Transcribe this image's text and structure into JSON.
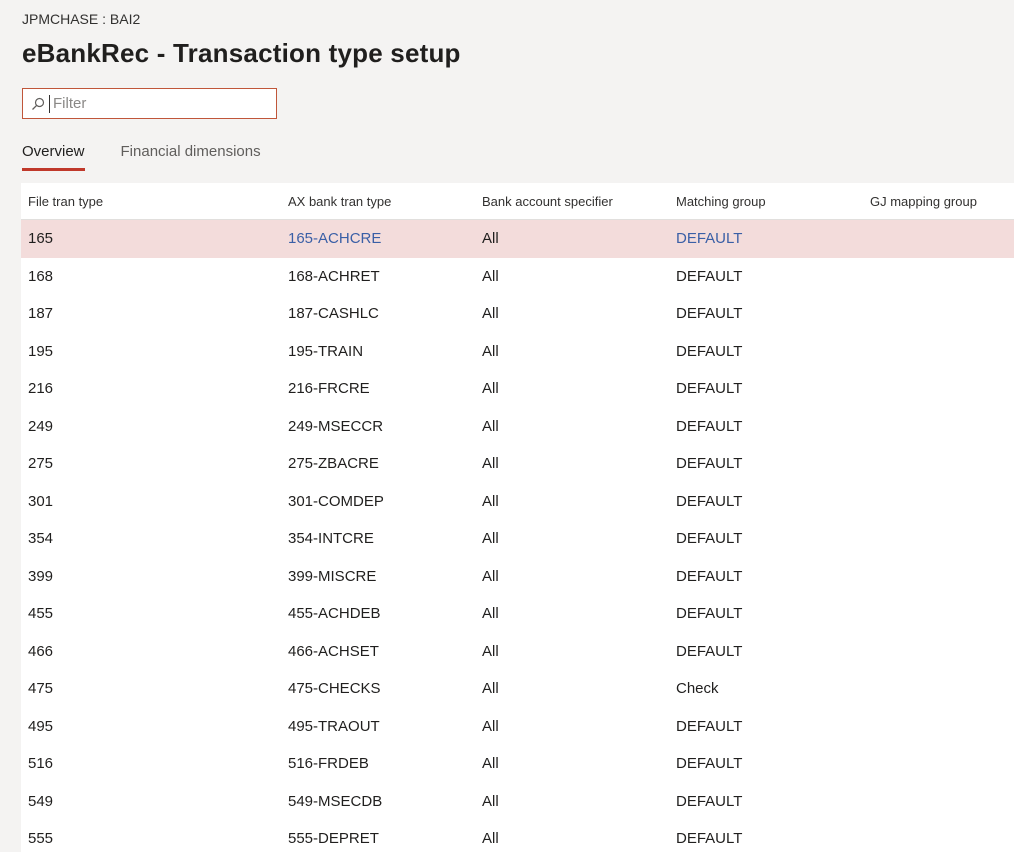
{
  "header": {
    "caption": "JPMCHASE : BAI2",
    "title": "eBankRec - Transaction type setup"
  },
  "filter": {
    "placeholder": "Filter",
    "value": ""
  },
  "tabs": [
    {
      "label": "Overview",
      "active": true
    },
    {
      "label": "Financial dimensions",
      "active": false
    }
  ],
  "grid": {
    "columns": [
      "File tran type",
      "AX bank tran type",
      "Bank account specifier",
      "Matching group",
      "GJ mapping group"
    ],
    "rows": [
      [
        "165",
        "165-ACHCRE",
        "All",
        "DEFAULT",
        ""
      ],
      [
        "168",
        "168-ACHRET",
        "All",
        "DEFAULT",
        ""
      ],
      [
        "187",
        "187-CASHLC",
        "All",
        "DEFAULT",
        ""
      ],
      [
        "195",
        "195-TRAIN",
        "All",
        "DEFAULT",
        ""
      ],
      [
        "216",
        "216-FRCRE",
        "All",
        "DEFAULT",
        ""
      ],
      [
        "249",
        "249-MSECCR",
        "All",
        "DEFAULT",
        ""
      ],
      [
        "275",
        "275-ZBACRE",
        "All",
        "DEFAULT",
        ""
      ],
      [
        "301",
        "301-COMDEP",
        "All",
        "DEFAULT",
        ""
      ],
      [
        "354",
        "354-INTCRE",
        "All",
        "DEFAULT",
        ""
      ],
      [
        "399",
        "399-MISCRE",
        "All",
        "DEFAULT",
        ""
      ],
      [
        "455",
        "455-ACHDEB",
        "All",
        "DEFAULT",
        ""
      ],
      [
        "466",
        "466-ACHSET",
        "All",
        "DEFAULT",
        ""
      ],
      [
        "475",
        "475-CHECKS",
        "All",
        "Check",
        ""
      ],
      [
        "495",
        "495-TRAOUT",
        "All",
        "DEFAULT",
        ""
      ],
      [
        "516",
        "516-FRDEB",
        "All",
        "DEFAULT",
        ""
      ],
      [
        "549",
        "549-MSECDB",
        "All",
        "DEFAULT",
        ""
      ],
      [
        "555",
        "555-DEPRET",
        "All",
        "DEFAULT",
        ""
      ]
    ],
    "selected_row": 0
  },
  "colors": {
    "accent": "#c0392b",
    "selected_row_bg": "#f3dcdb",
    "link_text": "#3a5fa6"
  },
  "icons": {
    "filter_icon": "search-icon"
  }
}
